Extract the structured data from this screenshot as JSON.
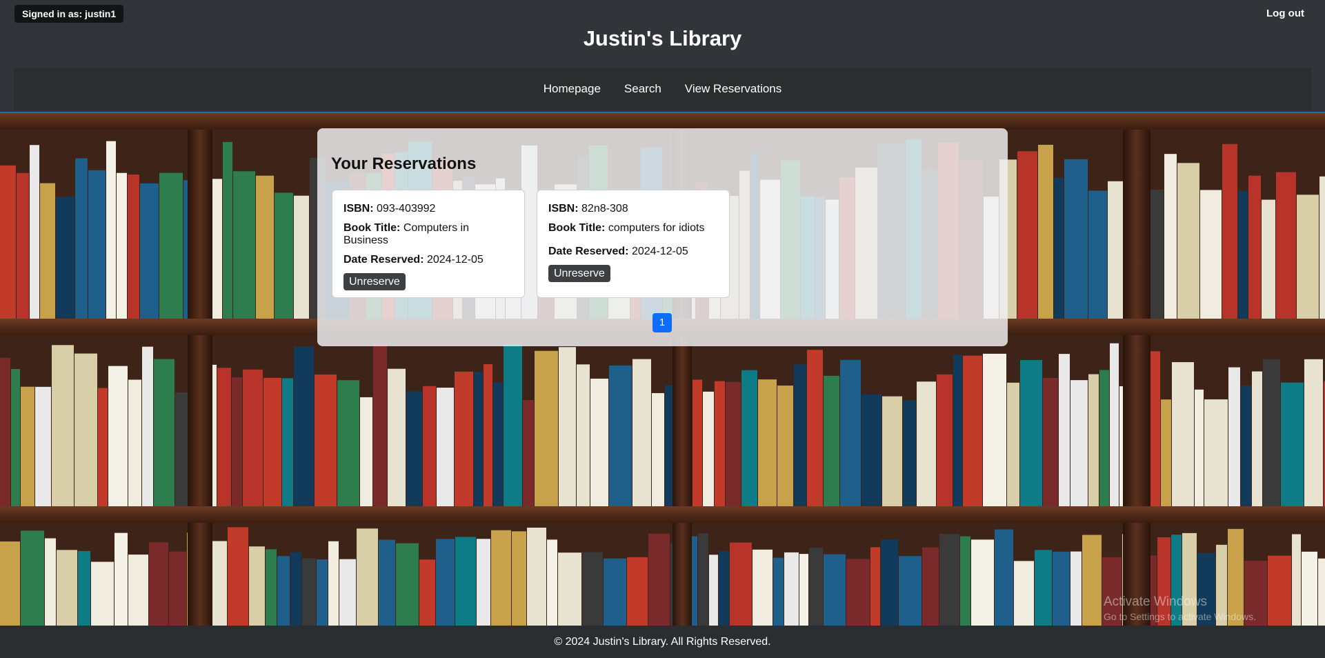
{
  "header": {
    "signed_in": "Signed in as: justin1",
    "logout": "Log out",
    "title": "Justin's Library"
  },
  "nav": {
    "items": [
      {
        "label": "Homepage"
      },
      {
        "label": "Search"
      },
      {
        "label": "View Reservations"
      }
    ]
  },
  "reservations": {
    "title": "Your Reservations",
    "labels": {
      "isbn": "ISBN:",
      "book_title": "Book Title:",
      "date_reserved": "Date Reserved:"
    },
    "items": [
      {
        "isbn": "093-403992",
        "book_title": "Computers in Business",
        "date_reserved": "2024-12-05",
        "action": "Unreserve"
      },
      {
        "isbn": "82n8-308",
        "book_title": "computers for idiots",
        "date_reserved": "2024-12-05",
        "action": "Unreserve"
      }
    ],
    "pagination": {
      "current_page": "1"
    }
  },
  "footer": {
    "text": "© 2024 Justin's Library. All Rights Reserved."
  },
  "watermark": {
    "title": "Activate Windows",
    "subtitle": "Go to Settings to activate Windows."
  },
  "colors": {
    "header_bg": "#31353a",
    "nav_bg": "#2b2d2f",
    "accent": "#0d6efd",
    "button_bg": "#3d3f42"
  }
}
